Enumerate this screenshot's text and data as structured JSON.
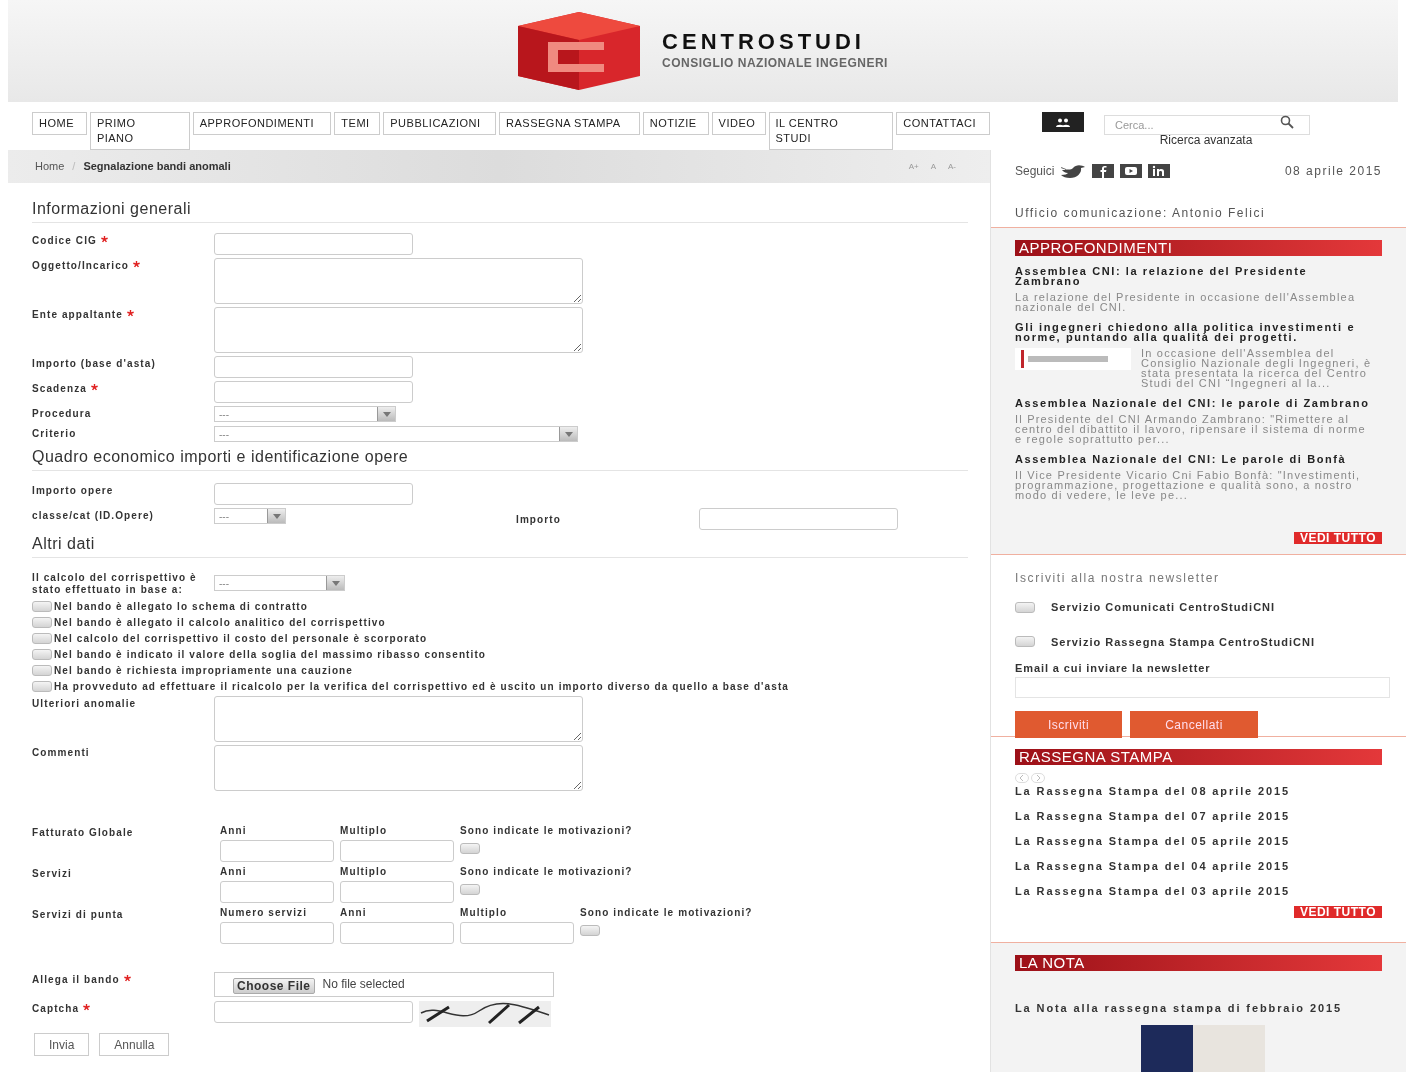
{
  "header": {
    "title": "CENTROSTUDI",
    "subtitle": "CONSIGLIO NAZIONALE INGEGNERI"
  },
  "nav": {
    "items": [
      "HOME",
      "PRIMO PIANO",
      "APPROFONDIMENTI",
      "TEMI",
      "PUBBLICAZIONI",
      "RASSEGNA STAMPA",
      "NOTIZIE",
      "VIDEO",
      "IL CENTRO STUDI",
      "CONTATTACI"
    ],
    "search_placeholder": "Cerca...",
    "advanced_search": "Ricerca avanzata"
  },
  "breadcrumb": [
    "Home",
    "Segnalazione bandi anomali"
  ],
  "breadcrumb_separator": "/",
  "font_size_controls": [
    "A+",
    "A",
    "A-"
  ],
  "general": {
    "title": "Informazioni generali",
    "fields": [
      {
        "label": "Codice CIG",
        "required": true,
        "kind": "text"
      },
      {
        "label": "Oggetto/Incarico",
        "required": true,
        "kind": "textarea"
      },
      {
        "label": "Ente appaltante",
        "required": true,
        "kind": "textarea"
      },
      {
        "label": "Importo (base d'asta)",
        "required": false,
        "kind": "text"
      },
      {
        "label": "Scadenza",
        "required": true,
        "kind": "text"
      },
      {
        "label": "Procedura",
        "required": false,
        "kind": "select",
        "value": "---"
      },
      {
        "label": "Criterio",
        "required": false,
        "kind": "select",
        "value": "---"
      }
    ]
  },
  "economic": {
    "title": "Quadro economico importi e identificazione opere",
    "importo_opere": "Importo opere",
    "classe": {
      "label": "classe/cat (ID.Opere)",
      "value": "---"
    },
    "importo": "Importo"
  },
  "other": {
    "title": "Altri dati",
    "calcolo": {
      "label": "Il calcolo del corrispettivo è stato effettuato in base a:",
      "value": "---"
    },
    "checks": [
      {
        "label": "Nel bando è allegato lo schema di contratto",
        "checked": false
      },
      {
        "label": "Nel bando è allegato il calcolo analitico del corrispettivo",
        "checked": false
      },
      {
        "label": "Nel calcolo del corrispettivo il costo del personale è scorporato",
        "checked": false
      },
      {
        "label": "Nel bando è indicato il valore della soglia del massimo ribasso consentito",
        "checked": false
      },
      {
        "label": "Nel bando è richiesta impropriamente una cauzione",
        "checked": false
      },
      {
        "label": "Ha provveduto ad effettuare il ricalcolo per la verifica del corrispettivo ed è uscito un importo diverso da quello a base d'asta",
        "checked": false
      }
    ],
    "ulteriori": "Ulteriori anomalie",
    "commenti": "Commenti"
  },
  "requirements": [
    {
      "label": "Fatturato Globale",
      "columns": [
        "Anni",
        "Multiplo"
      ],
      "question": "Sono indicate le motivazioni?",
      "checked": false
    },
    {
      "label": "Servizi",
      "columns": [
        "Anni",
        "Multiplo"
      ],
      "question": "Sono indicate le motivazioni?",
      "checked": false
    },
    {
      "label": "Servizi di punta",
      "columns": [
        "Numero servizi",
        "Anni",
        "Multiplo"
      ],
      "question": "Sono indicate le motivazioni?",
      "checked": false
    }
  ],
  "attachment": {
    "label": "Allega il bando",
    "required": true,
    "button": "Choose File",
    "status": "No file selected"
  },
  "captcha": {
    "label": "Captcha",
    "required": true
  },
  "buttons": [
    "Invia",
    "Annulla"
  ],
  "sidebar": {
    "follow_label": "Seguici",
    "date": "08 aprile 2015",
    "office": "Ufficio comunicazione: Antonio Felici",
    "approfondimenti": {
      "title": "APPROFONDIMENTI",
      "articles": [
        {
          "kind": "text",
          "title": "Assemblea CNI: la relazione del Presidente Zambrano",
          "summary": "La relazione del Presidente in occasione dell'Assemblea nazionale del CNI."
        },
        {
          "kind": "image",
          "title": "Gli ingegneri chiedono alla politica investimenti e norme, puntando alla qualità dei progetti.",
          "summary": "In occasione dell'Assemblea del Consiglio Nazionale degli Ingegneri, è stata presentata la ricerca del Centro Studi del CNI “Ingegneri al la..."
        },
        {
          "kind": "text",
          "title": "Assemblea Nazionale del CNI: le parole di Zambrano",
          "summary": "Il Presidente del CNI Armando Zambrano: \"Rimettere al centro del dibattito il lavoro, ripensare il sistema di norme e regole soprattutto per..."
        },
        {
          "kind": "text",
          "title": "Assemblea Nazionale del CNI: Le parole di Bonfà",
          "summary": "Il Vice Presidente Vicario Cni Fabio Bonfà: \"Investimenti, programmazione, progettazione e qualità sono, a nostro modo di vedere, le leve pe..."
        }
      ],
      "more": "VEDI TUTTO"
    },
    "newsletter": {
      "title": "Iscriviti alla nostra newsletter",
      "options": [
        {
          "label": "Servizio Comunicati CentroStudiCNI",
          "checked": false
        },
        {
          "label": "Servizio Rassegna Stampa CentroStudiCNI",
          "checked": false
        }
      ],
      "email_label": "Email a cui inviare la newsletter",
      "buttons": [
        "Iscriviti",
        "Cancellati"
      ]
    },
    "rassegna": {
      "title": "RASSEGNA STAMPA",
      "items": [
        "La Rassegna Stampa del 08 aprile 2015",
        "La Rassegna Stampa del 07 aprile 2015",
        "La Rassegna Stampa del 05 aprile 2015",
        "La Rassegna Stampa del 04 aprile 2015",
        "La Rassegna Stampa del 03 aprile 2015"
      ],
      "more": "VEDI TUTTO"
    },
    "nota": {
      "title": "LA NOTA",
      "item": "La Nota alla rassegna stampa di febbraio 2015"
    }
  }
}
